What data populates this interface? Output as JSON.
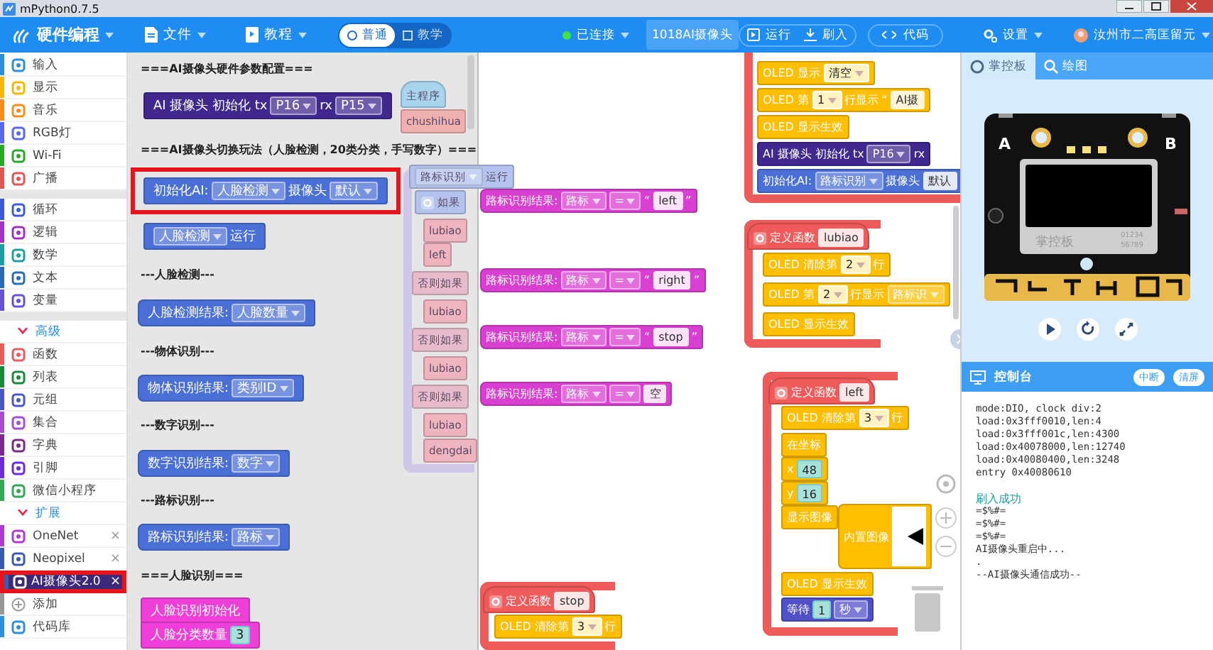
{
  "window": {
    "title": "mPython0.7.5"
  },
  "topbar": {
    "app": "硬件编程",
    "menus": [
      {
        "label": "文件"
      },
      {
        "label": "教程"
      }
    ],
    "mode": [
      {
        "label": "普通",
        "selected": true
      },
      {
        "label": "教学",
        "selected": false
      }
    ],
    "connection": {
      "label": "已连接",
      "connected": true
    },
    "device": "1018AI摄像头",
    "actions": [
      "运行",
      "刷入"
    ],
    "code": "代码",
    "settings": "设置",
    "user": "汝州市二高匡留元"
  },
  "sidebar": {
    "groups": [
      [
        {
          "kind": "category",
          "label": "输入",
          "color": "#2f8fd8",
          "selected": false
        },
        {
          "kind": "category",
          "label": "显示",
          "color": "#f6b900",
          "selected": false
        },
        {
          "kind": "category",
          "label": "音乐",
          "color": "#ff8c1a",
          "selected": false
        },
        {
          "kind": "category",
          "label": "RGB灯",
          "color": "#5b67f0",
          "selected": false
        },
        {
          "kind": "category",
          "label": "Wi-Fi",
          "color": "#29a829",
          "selected": false
        },
        {
          "kind": "category",
          "label": "广播",
          "color": "#e05555",
          "selected": false
        }
      ],
      [
        {
          "kind": "category",
          "label": "循环",
          "color": "#3b5bdb",
          "selected": false
        },
        {
          "kind": "category",
          "label": "逻辑",
          "color": "#a032c8",
          "selected": false
        },
        {
          "kind": "category",
          "label": "数学",
          "color": "#1aa0a0",
          "selected": false
        },
        {
          "kind": "category",
          "label": "文本",
          "color": "#2b6cb0",
          "selected": false
        },
        {
          "kind": "category",
          "label": "变量",
          "color": "#6a4fd8",
          "selected": false
        }
      ],
      [
        {
          "kind": "section",
          "label": "高级",
          "expanded": true,
          "selected": false
        },
        {
          "kind": "category",
          "label": "函数",
          "color": "#e85c5c",
          "selected": false
        },
        {
          "kind": "category",
          "label": "列表",
          "color": "#1b8a3a",
          "selected": false
        },
        {
          "kind": "category",
          "label": "元组",
          "color": "#4b57c5",
          "selected": false
        },
        {
          "kind": "category",
          "label": "集合",
          "color": "#a64fd0",
          "selected": false
        },
        {
          "kind": "category",
          "label": "字典",
          "color": "#7a2a8a",
          "selected": false
        },
        {
          "kind": "category",
          "label": "引脚",
          "color": "#6a2bd8",
          "selected": false
        },
        {
          "kind": "category",
          "label": "微信小程序",
          "color": "#35a855",
          "selected": false
        },
        {
          "kind": "section",
          "label": "扩展",
          "expanded": true,
          "selected": false
        },
        {
          "kind": "extension",
          "label": "OneNet",
          "close": "×",
          "color": "#b03ad0",
          "selected": false,
          "highlighted": false
        },
        {
          "kind": "extension",
          "label": "Neopixel",
          "close": "×",
          "color": "#3a5ab0",
          "selected": false,
          "highlighted": false
        },
        {
          "kind": "extension",
          "label": "AI摄像头2.0",
          "close": "×",
          "color": "#3a5ab0",
          "selected": true,
          "highlighted": true
        },
        {
          "kind": "action",
          "label": "添加",
          "color": "#999999",
          "selected": false
        },
        {
          "kind": "category",
          "label": "代码库",
          "color": "#2f8fd8",
          "selected": false
        }
      ]
    ]
  },
  "flyout": {
    "items": [
      {
        "kind": "heading",
        "text": "===AI摄像头硬件参数配置==="
      },
      {
        "kind": "statement",
        "color": "#40288f",
        "highlighted": false,
        "parts": [
          {
            "kind": "label",
            "text": "AI 摄像头 初始化 tx"
          },
          {
            "kind": "dropdown",
            "text": "P16"
          },
          {
            "kind": "label",
            "text": "rx"
          },
          {
            "kind": "dropdown",
            "text": "P15"
          }
        ]
      },
      {
        "kind": "heading",
        "text": "===AI摄像头切换玩法（人脸检测，20类分类，手写数字）==="
      },
      {
        "kind": "statement",
        "color": "#4a6fd6",
        "highlighted": true,
        "parts": [
          {
            "kind": "label",
            "text": "初始化AI:"
          },
          {
            "kind": "dropdown",
            "text": "人脸检测"
          },
          {
            "kind": "label",
            "text": "摄像头"
          },
          {
            "kind": "dropdown",
            "text": "默认"
          }
        ]
      },
      {
        "kind": "statement",
        "color": "#4a6fd6",
        "highlighted": false,
        "parts": [
          {
            "kind": "dropdown",
            "text": "人脸检测"
          },
          {
            "kind": "label",
            "text": "运行"
          }
        ]
      },
      {
        "kind": "heading",
        "text": "---人脸检测---"
      },
      {
        "kind": "value",
        "color": "#4a6fd6",
        "highlighted": false,
        "parts": [
          {
            "kind": "label",
            "text": "人脸检测结果:"
          },
          {
            "kind": "dropdown",
            "text": "人脸数量"
          }
        ]
      },
      {
        "kind": "heading",
        "text": "---物体识别---"
      },
      {
        "kind": "value",
        "color": "#4a6fd6",
        "highlighted": false,
        "parts": [
          {
            "kind": "label",
            "text": "物体识别结果:"
          },
          {
            "kind": "dropdown",
            "text": "类别ID"
          }
        ]
      },
      {
        "kind": "heading",
        "text": "---数字识别---"
      },
      {
        "kind": "value",
        "color": "#4a6fd6",
        "highlighted": false,
        "parts": [
          {
            "kind": "label",
            "text": "数字识别结果:"
          },
          {
            "kind": "dropdown",
            "text": "数字"
          }
        ]
      },
      {
        "kind": "heading",
        "text": "---路标识别---"
      },
      {
        "kind": "value",
        "color": "#4a6fd6",
        "highlighted": false,
        "parts": [
          {
            "kind": "label",
            "text": "路标识别结果:"
          },
          {
            "kind": "dropdown",
            "text": "路标"
          }
        ]
      },
      {
        "kind": "heading",
        "text": "===人脸识别==="
      },
      {
        "kind": "statement",
        "color": "#f03fd8",
        "highlighted": false,
        "parts": [
          {
            "kind": "label",
            "text": "人脸识别初始化"
          }
        ]
      },
      {
        "kind": "statement",
        "color": "#f03fd8",
        "highlighted": false,
        "parts": [
          {
            "kind": "label",
            "text": "人脸分类数量"
          },
          {
            "kind": "number",
            "text": "3"
          }
        ]
      }
    ]
  },
  "workspace": {
    "blocks": [
      {
        "kind": "hat",
        "color": "#a9d4ee",
        "parts": [
          {
            "kind": "label",
            "text": "主程序"
          }
        ]
      },
      {
        "kind": "statement",
        "color": "#f0b0b0",
        "parts": [
          {
            "kind": "label",
            "text": "chushihua"
          }
        ]
      },
      {
        "kind": "statement",
        "color": "#b4c2ee",
        "parts": [
          {
            "kind": "dropdown",
            "text": "路标识别"
          },
          {
            "kind": "label",
            "text": "运行"
          }
        ]
      },
      {
        "kind": "statement",
        "color": "#b4c2ee",
        "parts": [
          {
            "kind": "gear"
          },
          {
            "kind": "label",
            "text": "如果"
          }
        ]
      },
      {
        "kind": "statement",
        "color": "#eeb4c0",
        "parts": [
          {
            "kind": "label",
            "text": "lubiao"
          }
        ]
      },
      {
        "kind": "statement",
        "color": "#eeb4c0",
        "parts": [
          {
            "kind": "label",
            "text": "left"
          }
        ]
      },
      {
        "kind": "statement",
        "color": "#e8bccc",
        "parts": [
          {
            "kind": "label",
            "text": "否则如果"
          }
        ]
      },
      {
        "kind": "statement",
        "color": "#eeb4c0",
        "parts": [
          {
            "kind": "label",
            "text": "lubiao"
          }
        ]
      },
      {
        "kind": "statement",
        "color": "#e8bccc",
        "parts": [
          {
            "kind": "label",
            "text": "否则如果"
          }
        ]
      },
      {
        "kind": "statement",
        "color": "#eeb4c0",
        "parts": [
          {
            "kind": "label",
            "text": "lubiao"
          }
        ]
      },
      {
        "kind": "statement",
        "color": "#e8bccc",
        "parts": [
          {
            "kind": "label",
            "text": "否则如果"
          }
        ]
      },
      {
        "kind": "statement",
        "color": "#eeb4c0",
        "parts": [
          {
            "kind": "label",
            "text": "lubiao"
          }
        ]
      },
      {
        "kind": "statement",
        "color": "#eeb4c0",
        "parts": [
          {
            "kind": "label",
            "text": "dengdai"
          }
        ]
      },
      {
        "kind": "value",
        "color": "#d93fd0",
        "parts": [
          {
            "kind": "label",
            "text": "路标识别结果:"
          },
          {
            "kind": "dropdown",
            "text": "路标"
          },
          {
            "kind": "dropdown",
            "text": "="
          },
          {
            "kind": "label",
            "text": "“"
          },
          {
            "kind": "field",
            "text": "left"
          },
          {
            "kind": "label",
            "text": "”"
          }
        ]
      },
      {
        "kind": "value",
        "color": "#d93fd0",
        "parts": [
          {
            "kind": "label",
            "text": "路标识别结果:"
          },
          {
            "kind": "dropdown",
            "text": "路标"
          },
          {
            "kind": "dropdown",
            "text": "="
          },
          {
            "kind": "label",
            "text": "“"
          },
          {
            "kind": "field",
            "text": "right"
          },
          {
            "kind": "label",
            "text": "”"
          }
        ]
      },
      {
        "kind": "value",
        "color": "#d93fd0",
        "parts": [
          {
            "kind": "label",
            "text": "路标识别结果:"
          },
          {
            "kind": "dropdown",
            "text": "路标"
          },
          {
            "kind": "dropdown",
            "text": "="
          },
          {
            "kind": "label",
            "text": "“"
          },
          {
            "kind": "field",
            "text": "stop"
          },
          {
            "kind": "label",
            "text": "”"
          }
        ]
      },
      {
        "kind": "value",
        "color": "#d93fd0",
        "parts": [
          {
            "kind": "label",
            "text": "路标识别结果:"
          },
          {
            "kind": "dropdown",
            "text": "路标"
          },
          {
            "kind": "dropdown",
            "text": "="
          },
          {
            "kind": "field",
            "text": "空"
          }
        ]
      },
      {
        "kind": "statement",
        "color": "#ffbe00",
        "parts": [
          {
            "kind": "label",
            "text": "OLED 显示"
          },
          {
            "kind": "choice",
            "text": "清空"
          }
        ]
      },
      {
        "kind": "statement",
        "color": "#ffbe00",
        "parts": [
          {
            "kind": "label",
            "text": "OLED 第"
          },
          {
            "kind": "choice",
            "text": "1"
          },
          {
            "kind": "label",
            "text": "行显示"
          },
          {
            "kind": "label",
            "text": "“"
          },
          {
            "kind": "field",
            "text": "AI摄"
          }
        ]
      },
      {
        "kind": "statement",
        "color": "#ffbe00",
        "parts": [
          {
            "kind": "label",
            "text": "OLED 显示生效"
          }
        ]
      },
      {
        "kind": "statement",
        "color": "#40288f",
        "parts": [
          {
            "kind": "label",
            "text": "AI 摄像头 初始化 tx"
          },
          {
            "kind": "dropdown",
            "text": "P16"
          },
          {
            "kind": "label",
            "text": "rx"
          }
        ]
      },
      {
        "kind": "statement",
        "color": "#4a6fd6",
        "parts": [
          {
            "kind": "label",
            "text": "初始化AI:"
          },
          {
            "kind": "dropdown",
            "text": "路标识别"
          },
          {
            "kind": "label",
            "text": "摄像头"
          },
          {
            "kind": "field",
            "text": "默认"
          }
        ]
      },
      {
        "kind": "hat",
        "color": "#ef5b5b",
        "parts": [
          {
            "kind": "gear"
          },
          {
            "kind": "label",
            "text": "定义函数"
          },
          {
            "kind": "field",
            "text": "lubiao"
          }
        ]
      },
      {
        "kind": "statement",
        "color": "#ffbe00",
        "parts": [
          {
            "kind": "label",
            "text": "OLED 清除第"
          },
          {
            "kind": "choice",
            "text": "2"
          },
          {
            "kind": "label",
            "text": "行"
          }
        ]
      },
      {
        "kind": "statement",
        "color": "#ffbe00",
        "parts": [
          {
            "kind": "label",
            "text": "OLED 第"
          },
          {
            "kind": "choice",
            "text": "2"
          },
          {
            "kind": "label",
            "text": "行显示"
          },
          {
            "kind": "dropdown",
            "text": "路标识"
          }
        ]
      },
      {
        "kind": "statement",
        "color": "#ffbe00",
        "parts": [
          {
            "kind": "label",
            "text": "OLED 显示生效"
          }
        ]
      },
      {
        "kind": "hat",
        "color": "#ef5b5b",
        "parts": [
          {
            "kind": "gear"
          },
          {
            "kind": "label",
            "text": "定义函数"
          },
          {
            "kind": "field",
            "text": "left"
          }
        ]
      },
      {
        "kind": "statement",
        "color": "#ffbe00",
        "parts": [
          {
            "kind": "label",
            "text": "OLED 清除第"
          },
          {
            "kind": "choice",
            "text": "3"
          },
          {
            "kind": "label",
            "text": "行"
          }
        ]
      },
      {
        "kind": "statement",
        "color": "#ffbe00",
        "parts": [
          {
            "kind": "label",
            "text": "在坐标"
          }
        ]
      },
      {
        "kind": "statement",
        "color": "#ffbe00",
        "parts": [
          {
            "kind": "label",
            "text": "x"
          },
          {
            "kind": "number",
            "text": "48"
          }
        ]
      },
      {
        "kind": "statement",
        "color": "#ffbe00",
        "parts": [
          {
            "kind": "label",
            "text": "y"
          },
          {
            "kind": "number",
            "text": "16"
          }
        ]
      },
      {
        "kind": "statement",
        "color": "#ffbe00",
        "parts": [
          {
            "kind": "label",
            "text": "显示图像"
          }
        ]
      },
      {
        "kind": "value",
        "color": "#ffbe00",
        "parts": [
          {
            "kind": "label",
            "text": "内置图像"
          },
          {
            "kind": "image"
          }
        ]
      },
      {
        "kind": "statement",
        "color": "#ffbe00",
        "parts": [
          {
            "kind": "label",
            "text": "OLED 显示生效"
          }
        ]
      },
      {
        "kind": "statement",
        "color": "#5050c8",
        "parts": [
          {
            "kind": "label",
            "text": "等待"
          },
          {
            "kind": "number",
            "text": "1"
          },
          {
            "kind": "dropdown",
            "text": "秒"
          }
        ]
      },
      {
        "kind": "hat",
        "color": "#ef5b5b",
        "parts": [
          {
            "kind": "gear"
          },
          {
            "kind": "label",
            "text": "定义函数"
          },
          {
            "kind": "field",
            "text": "stop"
          }
        ]
      },
      {
        "kind": "statement",
        "color": "#ffbe00",
        "parts": [
          {
            "kind": "label",
            "text": "OLED 清除第"
          },
          {
            "kind": "choice",
            "text": "3"
          },
          {
            "kind": "label",
            "text": "行"
          }
        ]
      }
    ]
  },
  "panel": {
    "tabs": [
      {
        "label": "掌控板",
        "selected": true
      },
      {
        "label": "绘图",
        "selected": false
      }
    ],
    "board": {
      "labels": [
        "A",
        "B",
        "掌控板",
        "01234",
        "56789"
      ]
    },
    "console": {
      "title": "控制台",
      "buttons": [
        "中断",
        "清屏"
      ],
      "lines": [
        {
          "kind": "log",
          "text": "mode:DIO, clock div:2"
        },
        {
          "kind": "log",
          "text": "load:0x3fff0010,len:4"
        },
        {
          "kind": "log",
          "text": "load:0x3fff001c,len:4300"
        },
        {
          "kind": "log",
          "text": "load:0x40078000,len:12740"
        },
        {
          "kind": "log",
          "text": "load:0x40080400,len:3248"
        },
        {
          "kind": "log",
          "text": "entry 0x40080610"
        },
        {
          "kind": "success",
          "text": "刷入成功"
        },
        {
          "kind": "log",
          "text": "=$%#="
        },
        {
          "kind": "log",
          "text": "=$%#="
        },
        {
          "kind": "log",
          "text": "=$%#="
        },
        {
          "kind": "log",
          "text": "AI摄像头重启中..."
        },
        {
          "kind": "log",
          "text": "."
        },
        {
          "kind": "log",
          "text": "--AI摄像头通信成功--"
        }
      ]
    }
  }
}
